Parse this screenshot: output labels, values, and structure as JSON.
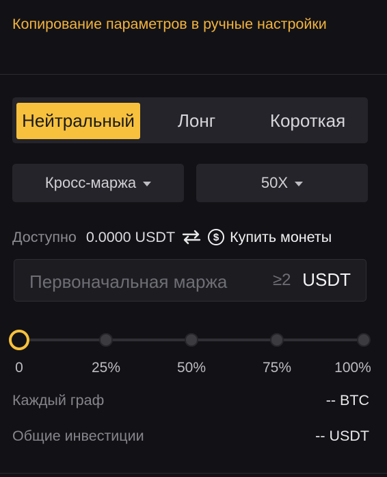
{
  "header": {
    "title": "Копирование параметров в ручные настройки"
  },
  "modes": {
    "items": [
      "Нейтральный",
      "Лонг",
      "Короткая"
    ],
    "selected": "Нейтральный"
  },
  "margin_mode": {
    "label": "Кросс-маржа"
  },
  "leverage": {
    "label": "50X"
  },
  "available": {
    "label": "Доступно",
    "value": "0.0000 USDT",
    "buy_label": "Купить монеты"
  },
  "initial_margin": {
    "placeholder": "Первоначальная маржа",
    "hint": "≥2",
    "unit": "USDT"
  },
  "slider": {
    "value_percent": 0,
    "marks": [
      "0",
      "25%",
      "50%",
      "75%",
      "100%"
    ]
  },
  "info": {
    "per_grid_label": "Каждый граф",
    "per_grid_value": "-- BTC",
    "total_label": "Общие инвестиции",
    "total_value": "-- USDT"
  },
  "colors": {
    "accent": "#f8c13d",
    "title": "#f2b33d",
    "background": "#121216"
  },
  "icons": {
    "swap": "swap-arrows-icon",
    "coin": "dollar-coin-icon",
    "caret": "caret-down-icon"
  }
}
